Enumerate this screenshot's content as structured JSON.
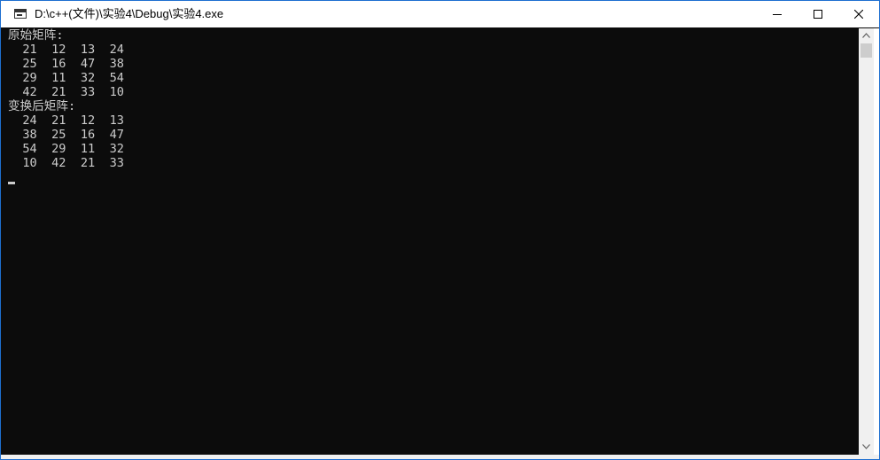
{
  "window": {
    "title": "D:\\c++(文件)\\实验4\\Debug\\实验4.exe",
    "icon": "console-app-icon",
    "controls": {
      "minimize": "minimize-icon",
      "maximize": "maximize-icon",
      "close": "close-icon"
    }
  },
  "console": {
    "lines": [
      "原始矩阵:",
      "  21  12  13  24",
      "  25  16  47  38",
      "  29  11  32  54",
      "  42  21  33  10",
      "变换后矩阵:",
      "  24  21  12  13",
      "  38  25  16  47",
      "  54  29  11  32",
      "  10  42  21  33"
    ],
    "colors": {
      "background": "#0c0c0c",
      "text": "#cccccc"
    }
  },
  "scrollbar": {
    "up": "scroll-up-arrow-icon",
    "down": "scroll-down-arrow-icon"
  }
}
